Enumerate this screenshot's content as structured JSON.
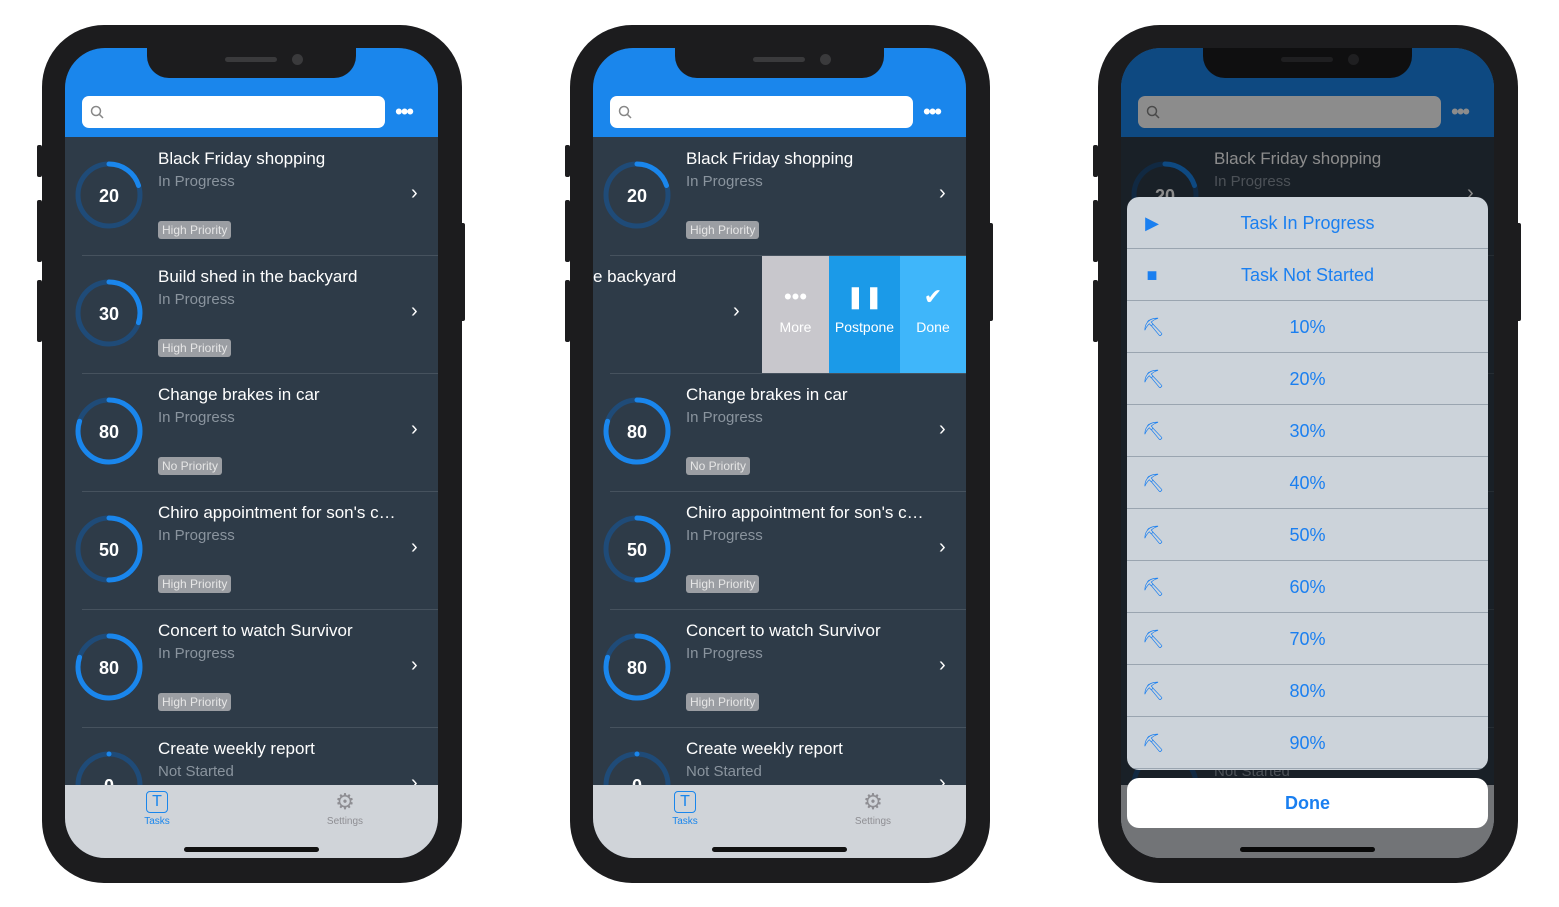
{
  "colors": {
    "accent": "#1a86ec",
    "list_bg": "#2e3b48",
    "ring_track": "#1f4b78",
    "ring_fill": "#1a86ec"
  },
  "search": {
    "placeholder": ""
  },
  "more_icon": "•••",
  "tasks": [
    {
      "title": "Black Friday shopping",
      "status": "In Progress",
      "progress": 20,
      "priority": "High Priority"
    },
    {
      "title": "Build shed in the backyard",
      "status": "In Progress",
      "progress": 30,
      "priority": "High Priority"
    },
    {
      "title": "Change brakes in car",
      "status": "In Progress",
      "progress": 80,
      "priority": "No Priority"
    },
    {
      "title": "Chiro appointment for son's c…",
      "status": "In Progress",
      "progress": 50,
      "priority": "High Priority"
    },
    {
      "title": "Concert to watch Survivor",
      "status": "In Progress",
      "progress": 80,
      "priority": "High Priority"
    },
    {
      "title": "Create weekly report",
      "status": "Not Started",
      "progress": 0,
      "priority": ""
    }
  ],
  "swipe": {
    "visible_title": "e backyard",
    "actions": [
      {
        "label": "More",
        "icon": "•••",
        "color": "#c8c7cc"
      },
      {
        "label": "Postpone",
        "icon": "❚❚",
        "color": "#1b9ae8"
      },
      {
        "label": "Done",
        "icon": "✔",
        "color": "#3fb6fa"
      }
    ]
  },
  "tabs": [
    {
      "label": "Tasks",
      "icon": "T",
      "active": true
    },
    {
      "label": "Settings",
      "icon": "⚙",
      "active": false
    }
  ],
  "sheet": {
    "items": [
      {
        "label": "Task In Progress",
        "icon": "▶"
      },
      {
        "label": "Task Not Started",
        "icon": "■"
      },
      {
        "label": "10%",
        "icon": "⛏"
      },
      {
        "label": "20%",
        "icon": "⛏"
      },
      {
        "label": "30%",
        "icon": "⛏"
      },
      {
        "label": "40%",
        "icon": "⛏"
      },
      {
        "label": "50%",
        "icon": "⛏"
      },
      {
        "label": "60%",
        "icon": "⛏"
      },
      {
        "label": "70%",
        "icon": "⛏"
      },
      {
        "label": "80%",
        "icon": "⛏"
      },
      {
        "label": "90%",
        "icon": "⛏"
      }
    ],
    "done_label": "Done"
  }
}
